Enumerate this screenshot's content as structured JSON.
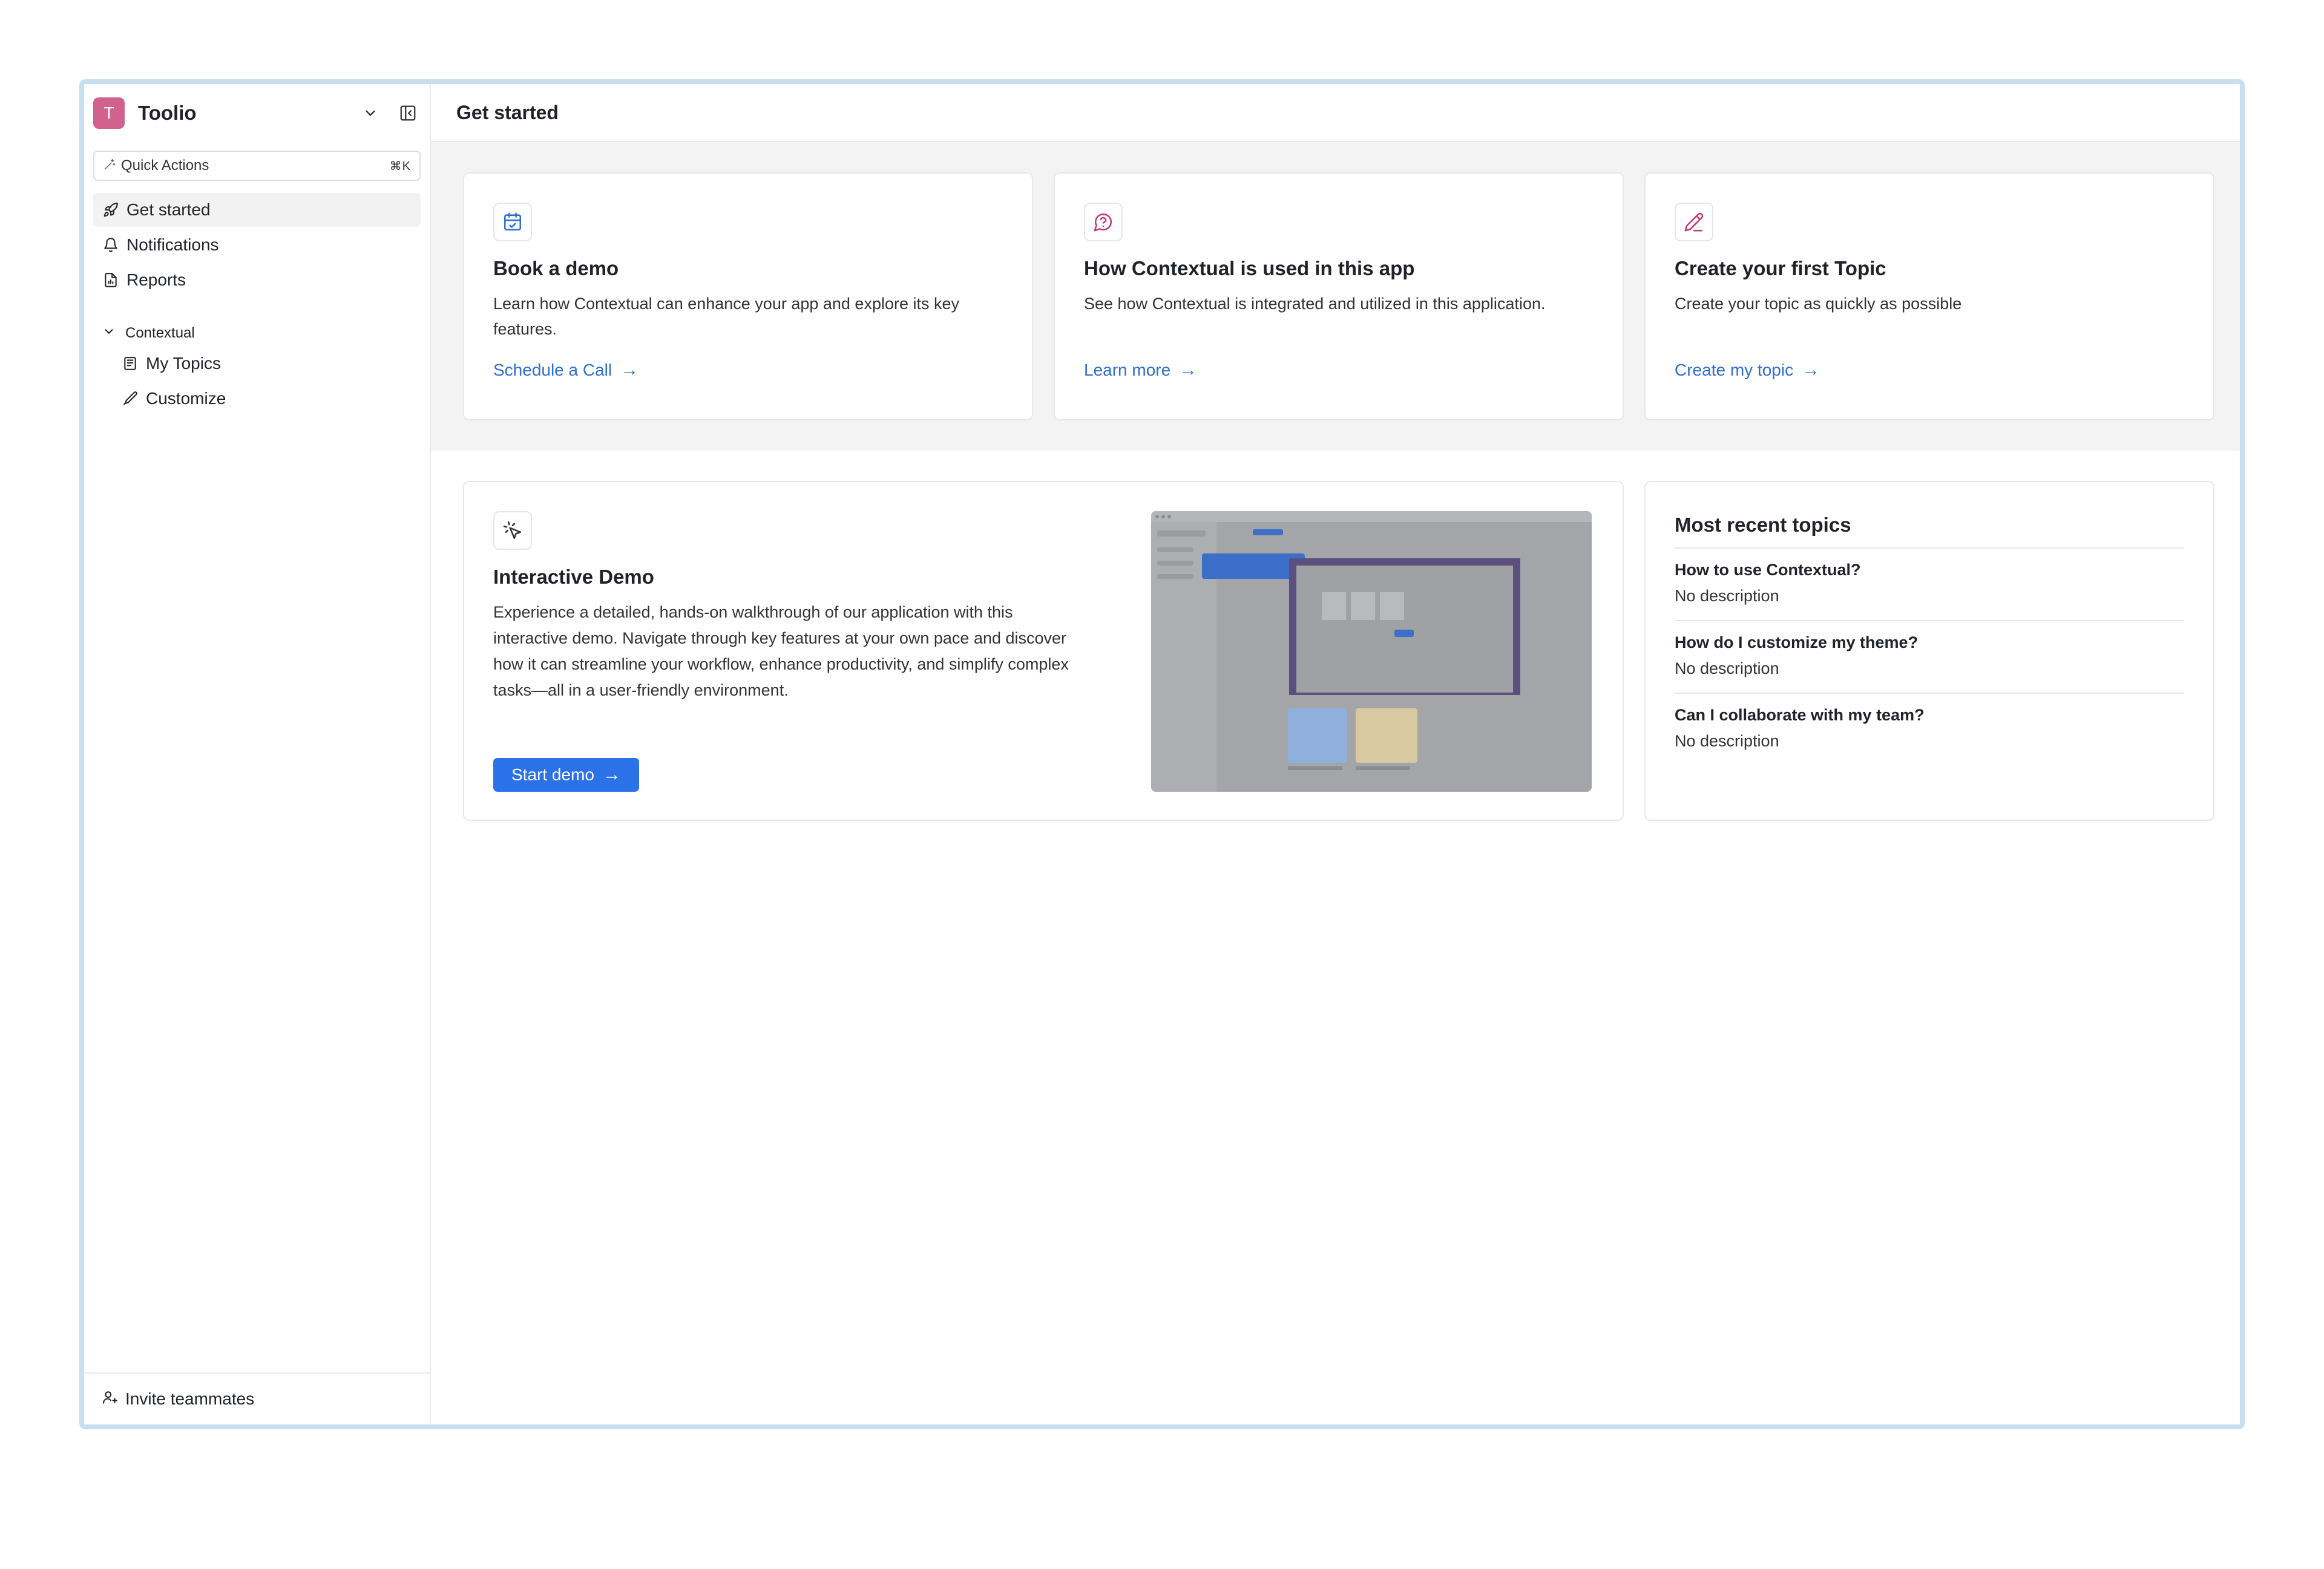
{
  "app": {
    "name": "Toolio",
    "avatar_letter": "T",
    "avatar_color": "#d1628f"
  },
  "sidebar": {
    "quick_actions": {
      "label": "Quick Actions",
      "shortcut": "⌘K"
    },
    "items": [
      {
        "label": "Get started",
        "icon": "rocket-icon",
        "active": true
      },
      {
        "label": "Notifications",
        "icon": "bell-icon"
      },
      {
        "label": "Reports",
        "icon": "report-icon"
      }
    ],
    "section": {
      "label": "Contextual",
      "items": [
        {
          "label": "My Topics",
          "icon": "topics-icon"
        },
        {
          "label": "Customize",
          "icon": "brush-icon"
        }
      ]
    },
    "footer": {
      "label": "Invite teammates",
      "icon": "user-plus-icon"
    }
  },
  "main": {
    "title": "Get started",
    "cards": [
      {
        "icon": "calendar-check-icon",
        "title": "Book a demo",
        "body": "Learn how Contextual can enhance your app and explore its key features.",
        "link": "Schedule a Call"
      },
      {
        "icon": "message-question-icon",
        "title": "How Contextual is used in this app",
        "body": "See how Contextual is integrated and utilized in this application.",
        "link": "Learn more"
      },
      {
        "icon": "pencil-icon",
        "title": "Create your first Topic",
        "body": "Create your topic as quickly as possible",
        "link": "Create my topic"
      }
    ],
    "demo": {
      "icon": "pointer-click-icon",
      "title": "Interactive Demo",
      "body": "Experience a detailed, hands-on walkthrough of our application with this interactive demo. Navigate through key features at your own pace and discover how it can streamline your workflow, enhance productivity, and simplify complex tasks—all in a user-friendly environment.",
      "button": "Start demo"
    },
    "recent": {
      "title": "Most recent topics",
      "topics": [
        {
          "title": "How to use Contextual?",
          "description": "No description"
        },
        {
          "title": "How do I customize my theme?",
          "description": "No description"
        },
        {
          "title": "Can I collaborate with my team?",
          "description": "No description"
        }
      ]
    }
  },
  "colors": {
    "accent": "#2b72e8",
    "link": "#2e6fce",
    "frame": "#c7dff0"
  }
}
